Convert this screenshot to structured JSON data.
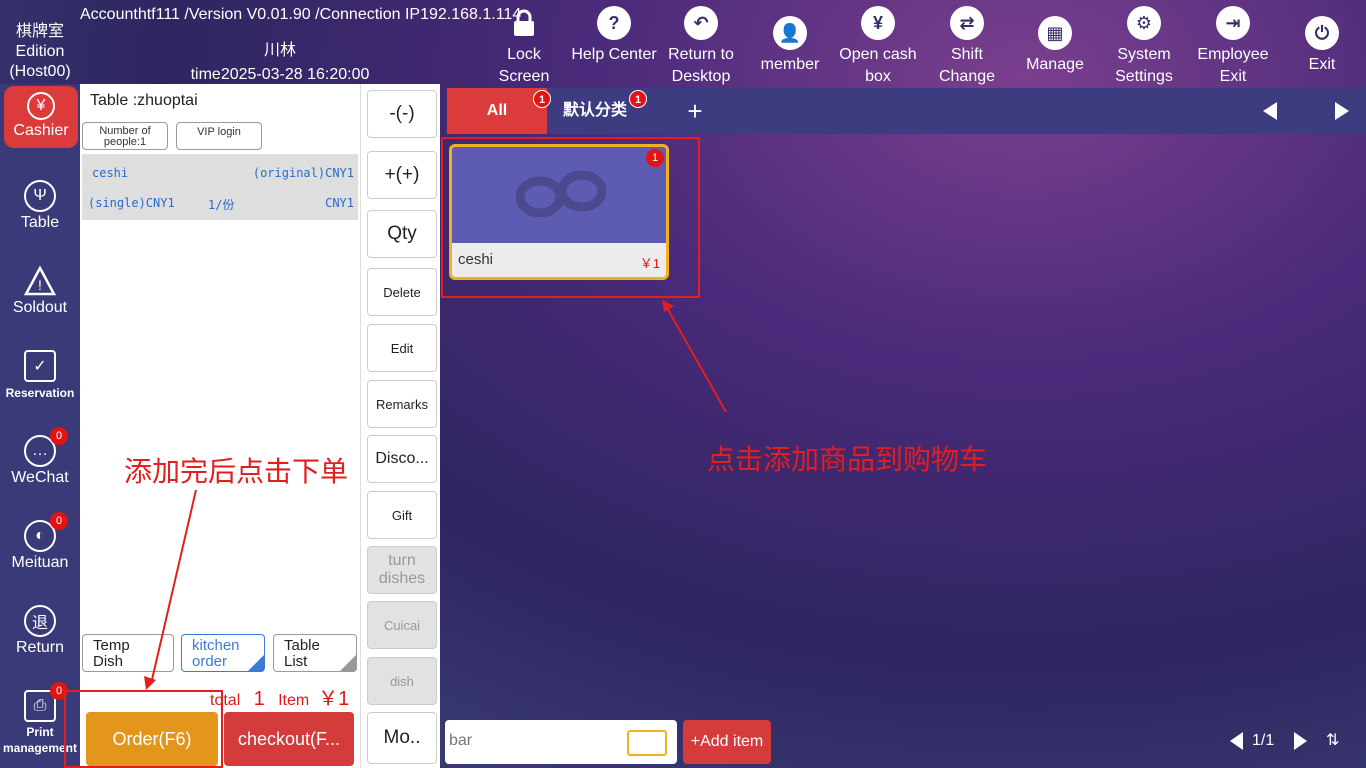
{
  "header": {
    "brand": [
      "棋牌室",
      "Edition",
      "(Host00)"
    ],
    "account_line": "Accounthtf111 /Version V0.01.90 /Connection IP192.168.1.114",
    "shop_name": "川林",
    "time": "time2025-03-28 16:20:00",
    "buttons": [
      {
        "label": [
          "Lock",
          "Screen"
        ],
        "icon": "lock-icon"
      },
      {
        "label": [
          "Help Center"
        ],
        "icon": "help-icon"
      },
      {
        "label": [
          "Return to",
          "Desktop"
        ],
        "icon": "return-icon"
      },
      {
        "label": [
          "member"
        ],
        "icon": "member-icon"
      },
      {
        "label": [
          "Open cash",
          "box"
        ],
        "icon": "cash-box-icon"
      },
      {
        "label": [
          "Shift",
          "Change"
        ],
        "icon": "shift-change-icon"
      },
      {
        "label": [
          "Manage"
        ],
        "icon": "manage-icon"
      },
      {
        "label": [
          "System",
          "Settings"
        ],
        "icon": "settings-icon"
      },
      {
        "label": [
          "Employee",
          "Exit"
        ],
        "icon": "employee-exit-icon"
      },
      {
        "label": [
          "Exit"
        ],
        "icon": "power-icon"
      }
    ]
  },
  "nav": [
    {
      "label": "Cashier",
      "icon": "yen-icon",
      "active": true
    },
    {
      "label": "Table",
      "icon": "fork-knife-icon"
    },
    {
      "label": "Soldout",
      "icon": "warning-icon"
    },
    {
      "label": "Reservation",
      "icon": "clipboard-check-icon"
    },
    {
      "label": "WeChat",
      "icon": "wechat-icon",
      "badge": "0"
    },
    {
      "label": "Meituan",
      "icon": "meituan-icon",
      "badge": "0"
    },
    {
      "label": "Return",
      "icon": "return-money-icon"
    },
    {
      "label": "Print management",
      "icon": "printer-icon",
      "badge": "0"
    }
  ],
  "order": {
    "table": "Table :zhuoptai",
    "people": "Number of people:1",
    "vip": "VIP login",
    "items": [
      {
        "name": "ceshi",
        "original": "(original)CNY1",
        "single": "(single)CNY1",
        "qty": "1/份",
        "total": "CNY1"
      }
    ],
    "temp_dish": [
      "Temp",
      "Dish"
    ],
    "kitchen_order": [
      "kitchen",
      "order"
    ],
    "table_list": [
      "Table",
      "List"
    ],
    "total_label": "total",
    "total_count": "1",
    "total_unit": "Item",
    "total_amount": "￥1",
    "order_button": "Order(F6)",
    "checkout_button": "checkout(F..."
  },
  "actions": [
    {
      "label": "-(-)",
      "big": true
    },
    {
      "label": "+(+)",
      "big": true
    },
    {
      "label": "Qty",
      "big": true
    },
    {
      "label": "Delete"
    },
    {
      "label": "Edit"
    },
    {
      "label": "Remarks"
    },
    {
      "label": "Disco...",
      "big": true
    },
    {
      "label": "Gift"
    },
    {
      "label": "turn dishes",
      "disabled": true,
      "big": true
    },
    {
      "label": "Cuicai",
      "disabled": true
    },
    {
      "label": "dish",
      "disabled": true
    },
    {
      "label": "Mo..",
      "big": true
    }
  ],
  "categories": [
    {
      "label": "All",
      "badge": "1",
      "active": true
    },
    {
      "label": "默认分类",
      "badge": "1"
    }
  ],
  "add_category": "+",
  "products": [
    {
      "name": "ceshi",
      "price": "￥1",
      "badge": "1"
    }
  ],
  "annotations": {
    "add_then_order": "添加完后点击下单",
    "click_to_add": "点击添加商品到购物车"
  },
  "search": {
    "placeholder": "bar"
  },
  "add_item": "+Add item",
  "pager": {
    "page": "1/1"
  },
  "colors": {
    "accent_red": "#d43b3b",
    "order_orange": "#e3961b",
    "nav_bg": "#3b3a78",
    "card_border": "#f0b11c"
  }
}
